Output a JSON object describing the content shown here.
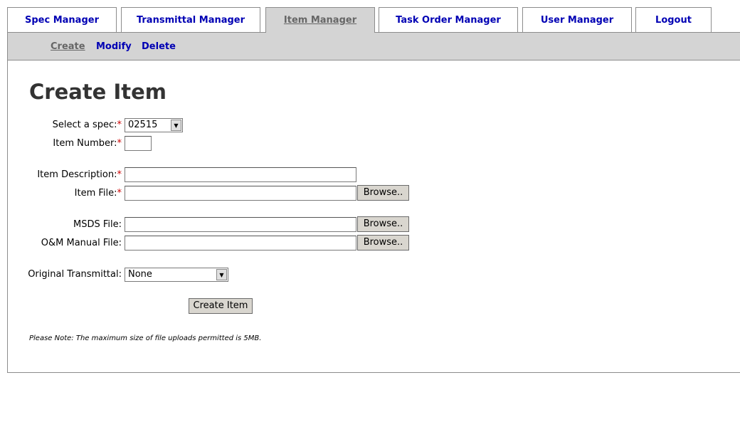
{
  "tabs": [
    {
      "label": "Spec Manager"
    },
    {
      "label": "Transmittal Manager"
    },
    {
      "label": "Item Manager"
    },
    {
      "label": "Task Order Manager"
    },
    {
      "label": "User Manager"
    },
    {
      "label": "Logout"
    }
  ],
  "subnav": {
    "create": "Create",
    "modify": "Modify",
    "delete": "Delete"
  },
  "page": {
    "title": "Create Item",
    "required_marker": "*",
    "note": "Please Note: The maximum size of file uploads permitted is 5MB."
  },
  "form": {
    "spec_label": "Select a spec:",
    "spec_value": "02515",
    "item_number_label": "Item Number:",
    "item_number_value": "",
    "item_description_label": "Item Description:",
    "item_description_value": "",
    "item_file_label": "Item File:",
    "msds_file_label": "MSDS File:",
    "om_manual_label": "O&M Manual File:",
    "browse_label": "Browse..",
    "original_transmittal_label": "Original Transmittal:",
    "original_transmittal_value": "None",
    "submit_label": "Create Item"
  },
  "colors": {
    "link": "#0000b4",
    "active_tab_bg": "#d4d4d4",
    "required": "#cc0000"
  }
}
